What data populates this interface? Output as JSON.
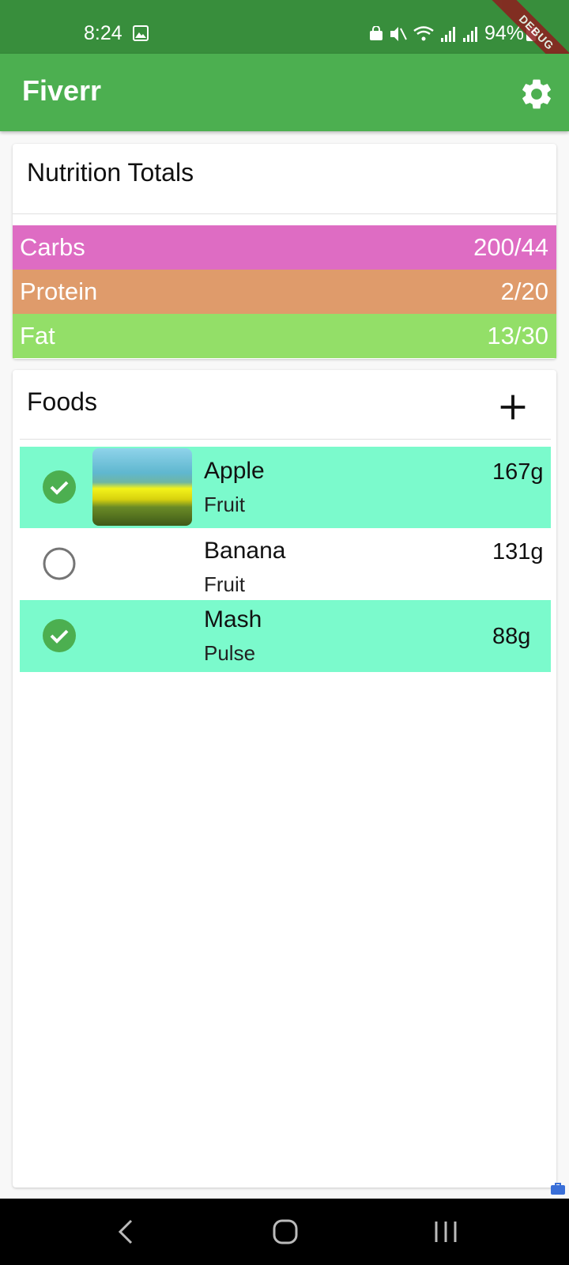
{
  "status_bar": {
    "time": "8:24",
    "battery": "94%"
  },
  "debug_banner": "DEBUG",
  "app_bar": {
    "title": "Fiverr",
    "settings_icon": "gear-icon"
  },
  "totals": {
    "title": "Nutrition Totals",
    "rows": [
      {
        "label": "Carbs",
        "value": "200/44",
        "color": "#de6cc3"
      },
      {
        "label": "Protein",
        "value": "2/20",
        "color": "#df9b6b"
      },
      {
        "label": "Fat",
        "value": "13/30",
        "color": "#93df68"
      }
    ]
  },
  "foods": {
    "title": "Foods",
    "add_icon": "plus-icon",
    "items": [
      {
        "name": "Apple",
        "category": "Fruit",
        "weight": "167g",
        "selected": true,
        "has_image": true
      },
      {
        "name": "Banana",
        "category": "Fruit",
        "weight": "131g",
        "selected": false,
        "has_image": false
      },
      {
        "name": "Mash",
        "category": "Pulse",
        "weight": "88g",
        "selected": true,
        "has_image": false
      }
    ]
  },
  "colors": {
    "status_bar": "#388e3c",
    "app_bar": "#4caf50",
    "selected_row": "#7bfacc",
    "check": "#4caf50"
  }
}
